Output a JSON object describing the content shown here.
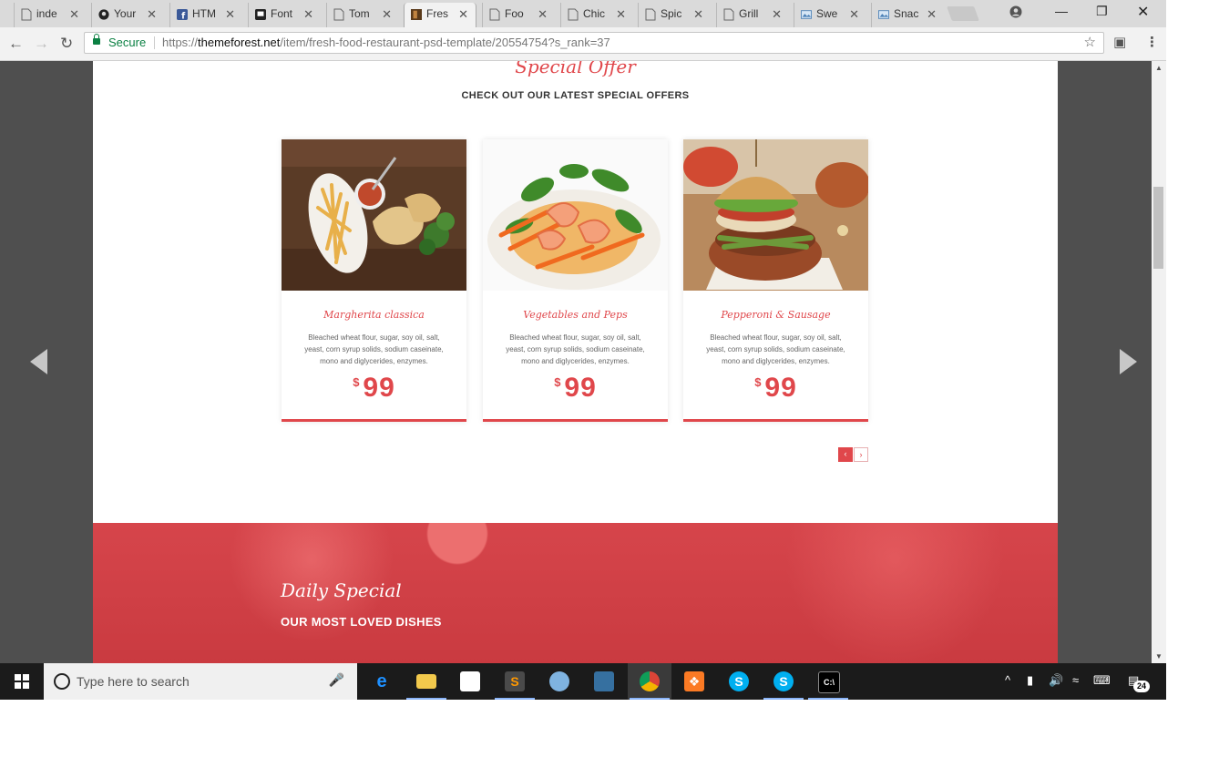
{
  "browser": {
    "tabs": [
      {
        "label": "inde",
        "favicon": "page-icon"
      },
      {
        "label": "Your",
        "favicon": "github-icon"
      },
      {
        "label": "HTM",
        "favicon": "facebook-icon"
      },
      {
        "label": "Font",
        "favicon": "flag-icon"
      },
      {
        "label": "Tom",
        "favicon": "page-icon"
      },
      {
        "label": "Fres",
        "favicon": "themeforest-icon",
        "active": true
      },
      {
        "label": "Foo",
        "favicon": "page-icon"
      },
      {
        "label": "Chic",
        "favicon": "page-icon"
      },
      {
        "label": "Spic",
        "favicon": "page-icon"
      },
      {
        "label": "Grill",
        "favicon": "page-icon"
      },
      {
        "label": "Swe",
        "favicon": "image-icon"
      },
      {
        "label": "Snac",
        "favicon": "image-icon"
      }
    ],
    "secure_label": "Secure",
    "url_scheme": "https://",
    "url_host": "themeforest.net",
    "url_path": "/item/fresh-food-restaurant-psd-template/20554754?s_rank=37"
  },
  "page": {
    "section_title": "Special Offer",
    "section_subtitle": "CHECK OUT OUR LATEST SPECIAL OFFERS",
    "offers": [
      {
        "name": "Margherita classica",
        "description": "Bleached wheat flour, sugar, soy oil, salt, yeast, corn syrup solids, sodium caseinate, mono and diglycerides, enzymes.",
        "currency": "$",
        "price": "99"
      },
      {
        "name": "Vegetables and Peps",
        "description": "Bleached wheat flour, sugar, soy oil, salt, yeast, corn syrup solids, sodium caseinate, mono and diglycerides, enzymes.",
        "currency": "$",
        "price": "99"
      },
      {
        "name": "Pepperoni & Sausage",
        "description": "Bleached wheat flour, sugar, soy oil, salt, yeast, corn syrup solids, sodium caseinate, mono and diglycerides, enzymes.",
        "currency": "$",
        "price": "99"
      }
    ],
    "pager_prev": "‹",
    "pager_next": "›",
    "daily_title": "Daily Special",
    "daily_subtitle": "OUR MOST LOVED DISHES"
  },
  "taskbar": {
    "search_placeholder": "Type here to search",
    "apps": [
      "edge-icon",
      "file-explorer-icon",
      "store-icon",
      "sublime-text-icon",
      "paint-icon",
      "python-icon",
      "chrome-icon",
      "xampp-icon",
      "skype-icon",
      "skype-business-icon",
      "terminal-icon"
    ],
    "notification_count": "24"
  },
  "colors": {
    "accent": "#e0474b",
    "daily_bg": "#d6454b",
    "viewer_bg": "#4f4f4f"
  }
}
